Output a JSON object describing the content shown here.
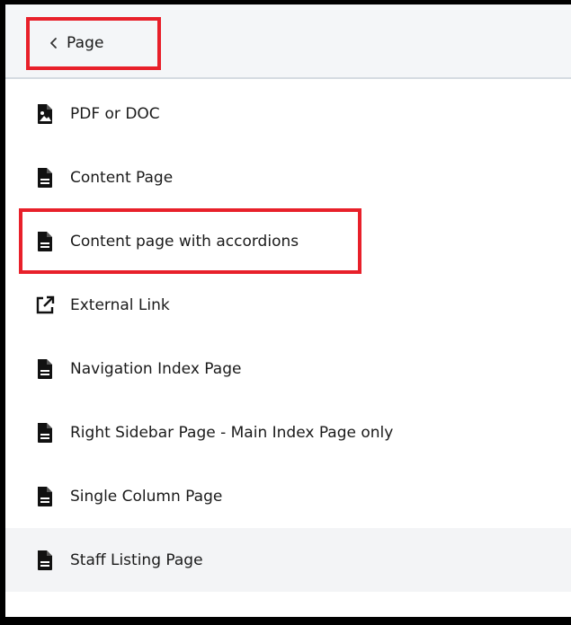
{
  "header": {
    "back_label": "Page"
  },
  "menu": {
    "items": [
      {
        "label": "PDF or DOC",
        "icon": "file-image-icon"
      },
      {
        "label": "Content Page",
        "icon": "file-text-icon"
      },
      {
        "label": "Content page with accordions",
        "icon": "file-text-icon"
      },
      {
        "label": "External Link",
        "icon": "external-link-icon"
      },
      {
        "label": "Navigation Index Page",
        "icon": "file-text-icon"
      },
      {
        "label": "Right Sidebar Page - Main Index Page only",
        "icon": "file-text-icon"
      },
      {
        "label": "Single Column Page",
        "icon": "file-text-icon"
      },
      {
        "label": "Staff Listing Page",
        "icon": "file-text-icon"
      }
    ]
  },
  "colors": {
    "highlight": "#e8202a",
    "header_bg": "#f4f6f8",
    "hover_bg": "#f3f4f6",
    "text": "#1a1a1a"
  }
}
